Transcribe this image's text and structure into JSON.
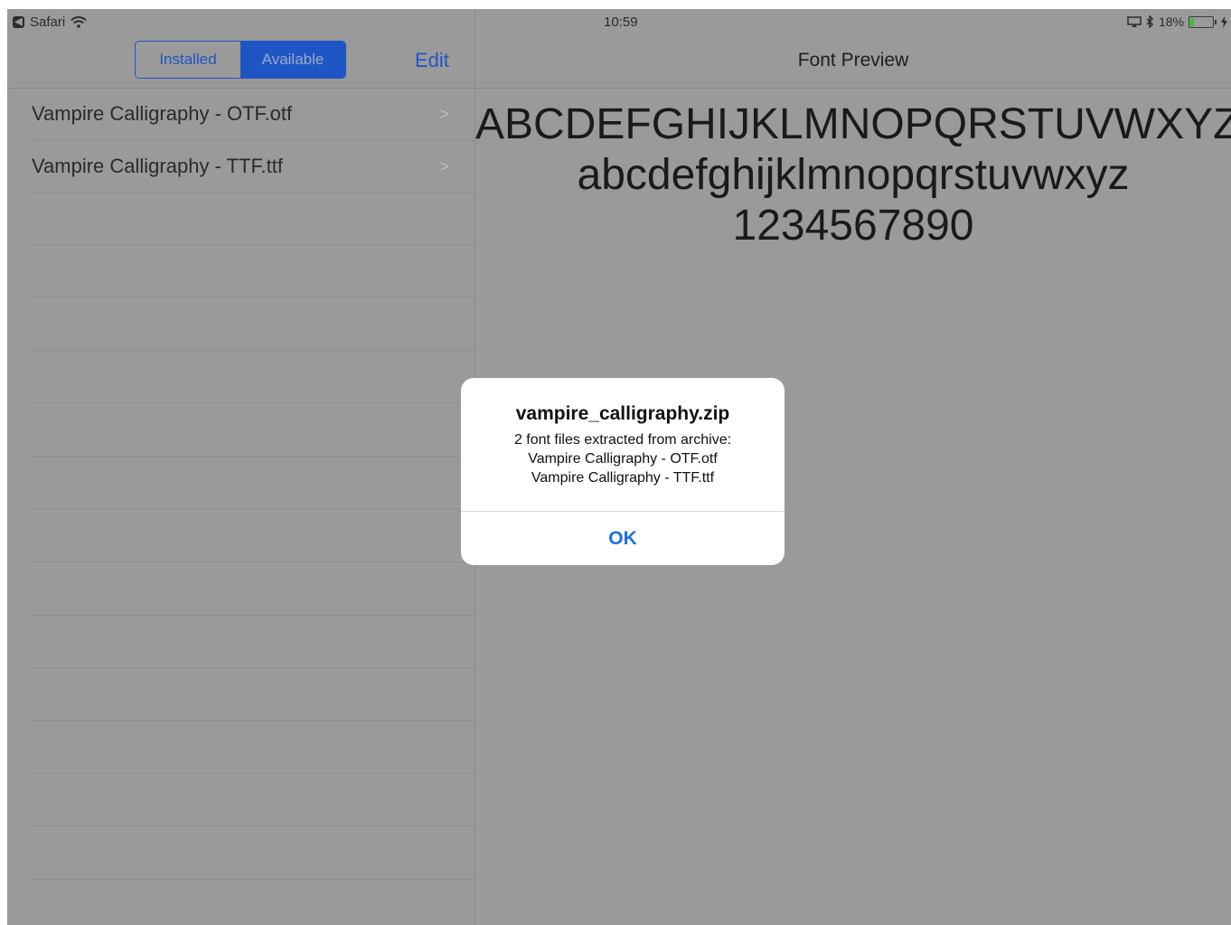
{
  "status_bar": {
    "back_app": "Safari",
    "time": "10:59",
    "battery_percent": "18%",
    "battery_level": 0.18
  },
  "left_pane": {
    "segments": [
      "Installed",
      "Available"
    ],
    "selected_segment": "Available",
    "edit_label": "Edit",
    "fonts": [
      {
        "label": "Vampire Calligraphy - OTF.otf"
      },
      {
        "label": "Vampire Calligraphy - TTF.ttf"
      }
    ]
  },
  "right_pane": {
    "title": "Font Preview",
    "preview_lines": [
      "ABCDEFGHIJKLMNOPQRSTUVWXYZ",
      "abcdefghijklmnopqrstuvwxyz",
      "1234567890"
    ]
  },
  "alert": {
    "title": "vampire_calligraphy.zip",
    "body_lines": [
      "2 font files extracted from archive:",
      "Vampire Calligraphy - OTF.otf",
      "Vampire Calligraphy - TTF.ttf"
    ],
    "ok_label": "OK"
  },
  "colors": {
    "accent": "#1d56c4",
    "dim_background": "#9a9a9a",
    "alert_button": "#1d6fe0",
    "battery": "#3cbf2e"
  }
}
